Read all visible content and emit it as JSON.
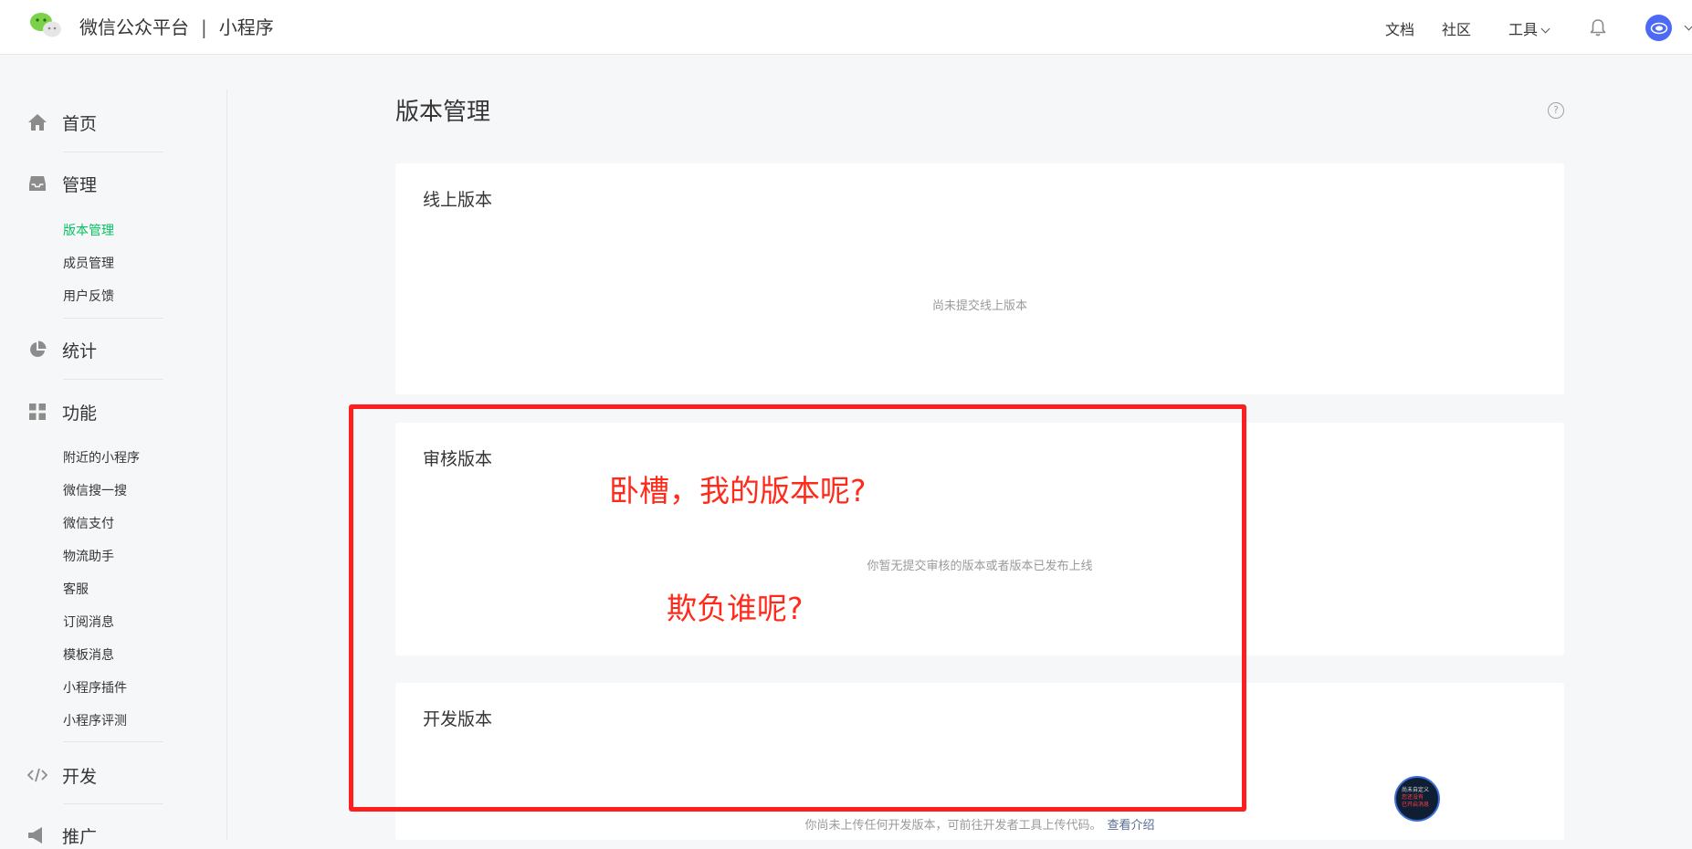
{
  "brand": {
    "name": "微信公众平台",
    "separator": "|",
    "product": "小程序"
  },
  "topnav": {
    "docs": "文档",
    "community": "社区",
    "tools": "工具"
  },
  "colors": {
    "accent_green": "#07c160",
    "annotation_red": "#ff1d1d",
    "avatar_blue": "#4e69f4"
  },
  "sidebar": {
    "groups": [
      {
        "label": "首页",
        "icon": "home-icon"
      },
      {
        "label": "管理",
        "icon": "inbox-icon"
      },
      {
        "label": "统计",
        "icon": "pie-chart-icon"
      },
      {
        "label": "功能",
        "icon": "grid-icon"
      },
      {
        "label": "开发",
        "icon": "code-icon"
      },
      {
        "label": "推广",
        "icon": "megaphone-icon"
      }
    ],
    "manage_items": [
      "版本管理",
      "成员管理",
      "用户反馈"
    ],
    "feature_items": [
      "附近的小程序",
      "微信搜一搜",
      "微信支付",
      "物流助手",
      "客服",
      "订阅消息",
      "模板消息",
      "小程序插件",
      "小程序评测"
    ],
    "active_item": "版本管理"
  },
  "main": {
    "title": "版本管理",
    "help": "?",
    "cards": [
      {
        "title": "线上版本",
        "empty": "尚未提交线上版本"
      },
      {
        "title": "审核版本",
        "empty": "你暂无提交审核的版本或者版本已发布上线"
      },
      {
        "title": "开发版本",
        "empty": "你尚未上传任何开发版本，可前往开发者工具上传代码。",
        "link": "查看介绍"
      }
    ]
  },
  "annotations": {
    "note1": "卧槽，我的版本呢?",
    "note2": "欺负谁呢?"
  },
  "floating_widget": {
    "line1": "尚未自定义",
    "line2": "您还没有",
    "line3": "已开启消息"
  }
}
